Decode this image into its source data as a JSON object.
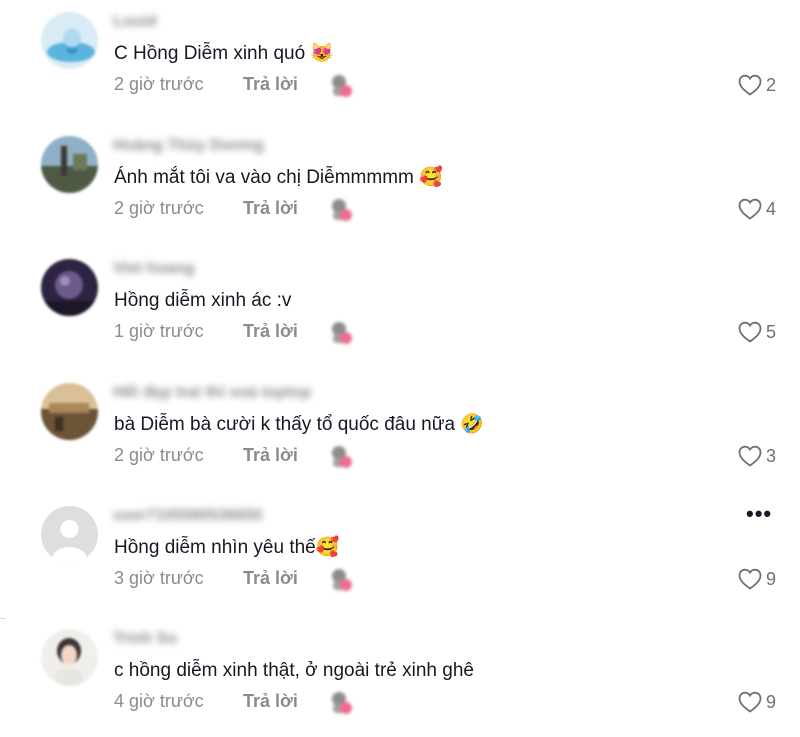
{
  "reply_label": "Trả lời",
  "comments": [
    {
      "username": "Louid",
      "text": "C Hồng Diễm xinh quó 😻",
      "time": "2 giờ trước",
      "likes": "2",
      "avatar_icon": "balloon-avatar",
      "avatar_colors": [
        "#cfe7f5",
        "#5eb4de"
      ]
    },
    {
      "username": "Hoàng Thùy Dương",
      "text": "Ánh mắt tôi va vào chị Diễmmmmm 🥰",
      "time": "2 giờ trước",
      "likes": "4",
      "avatar_icon": "landscape-avatar",
      "avatar_colors": [
        "#7e9fb6",
        "#55614a"
      ]
    },
    {
      "username": "Viet hoang",
      "text": "Hồng diễm xinh ác :v",
      "time": "1 giờ trước",
      "likes": "5",
      "avatar_icon": "purple-avatar",
      "avatar_colors": [
        "#6c5a8a",
        "#2a1f3c"
      ]
    },
    {
      "username": "Hết đẹp trai thì xoá toptop",
      "text": "bà Diễm bà cười k thấy tổ quốc đâu nữa 🤣",
      "time": "2 giờ trước",
      "likes": "3",
      "avatar_icon": "sunset-avatar",
      "avatar_colors": [
        "#c8a26a",
        "#5b4632"
      ]
    },
    {
      "username": "user7105580536650",
      "text": "Hồng diễm nhìn yêu thế🥰",
      "time": "3 giờ trước",
      "likes": "9",
      "avatar_icon": "default-user-avatar",
      "avatar_colors": [
        "#d7d7d9",
        "#ffffff"
      ]
    },
    {
      "username": "Trinh Su",
      "text": "c hồng diễm xinh thật, ở ngoài trẻ xinh ghê",
      "time": "4 giờ trước",
      "likes": "9",
      "avatar_icon": "portrait-avatar",
      "avatar_colors": [
        "#eceae6",
        "#3b3434"
      ]
    }
  ],
  "more_label": "•••",
  "colors": {
    "text": "#161823",
    "secondary": "#8a8b91",
    "heart": "#6f7075"
  }
}
